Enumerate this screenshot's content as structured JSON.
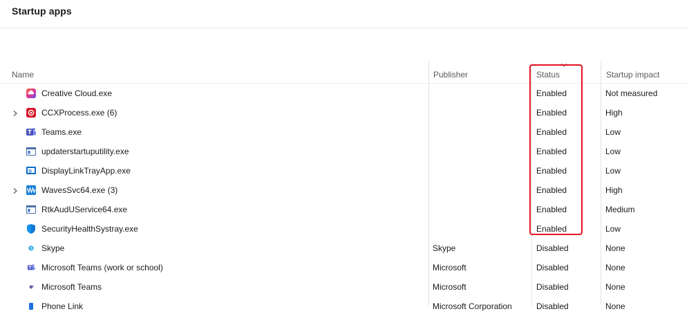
{
  "page": {
    "title": "Startup apps"
  },
  "table": {
    "columns": {
      "name": "Name",
      "publisher": "Publisher",
      "status": "Status",
      "impact": "Startup impact"
    },
    "rows": [
      {
        "name": "Creative Cloud.exe",
        "publisher": "",
        "status": "Enabled",
        "impact": "Not measured",
        "icon": "creative-cloud-icon",
        "expandable": false
      },
      {
        "name": "CCXProcess.exe (6)",
        "publisher": "",
        "status": "Enabled",
        "impact": "High",
        "icon": "ccx-process-icon",
        "expandable": true
      },
      {
        "name": "Teams.exe",
        "publisher": "",
        "status": "Enabled",
        "impact": "Low",
        "icon": "teams-icon",
        "expandable": false
      },
      {
        "name": "updaterstartuputility.exe",
        "publisher": "",
        "status": "Enabled",
        "impact": "Low",
        "icon": "app-window-icon",
        "expandable": false
      },
      {
        "name": "DisplayLinkTrayApp.exe",
        "publisher": "",
        "status": "Enabled",
        "impact": "Low",
        "icon": "displaylink-icon",
        "expandable": false
      },
      {
        "name": "WavesSvc64.exe (3)",
        "publisher": "",
        "status": "Enabled",
        "impact": "High",
        "icon": "waves-icon",
        "expandable": true
      },
      {
        "name": "RtkAudUService64.exe",
        "publisher": "",
        "status": "Enabled",
        "impact": "Medium",
        "icon": "app-window-icon",
        "expandable": false
      },
      {
        "name": "SecurityHealthSystray.exe",
        "publisher": "",
        "status": "Enabled",
        "impact": "Low",
        "icon": "security-shield-icon",
        "expandable": false
      },
      {
        "name": "Skype",
        "publisher": "Skype",
        "status": "Disabled",
        "impact": "None",
        "icon": "skype-icon",
        "expandable": false
      },
      {
        "name": "Microsoft Teams (work or school)",
        "publisher": "Microsoft",
        "status": "Disabled",
        "impact": "None",
        "icon": "teams-work-icon",
        "expandable": false
      },
      {
        "name": "Microsoft Teams",
        "publisher": "Microsoft",
        "status": "Disabled",
        "impact": "None",
        "icon": "teams-small-icon",
        "expandable": false
      },
      {
        "name": "Phone Link",
        "publisher": "Microsoft Corporation",
        "status": "Disabled",
        "impact": "None",
        "icon": "phone-link-icon",
        "expandable": false
      }
    ]
  },
  "colors": {
    "highlight": "#e81123",
    "divider": "#e3e3e3"
  }
}
